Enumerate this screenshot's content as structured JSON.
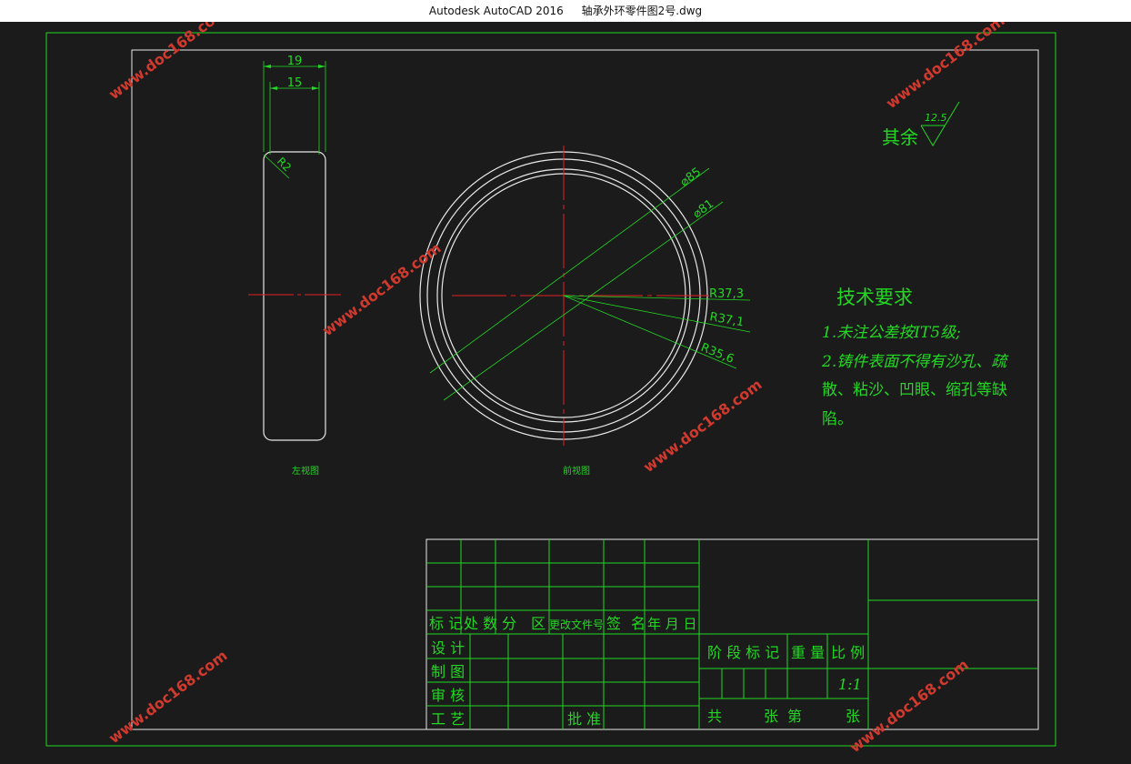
{
  "titlebar": {
    "app": "Autodesk AutoCAD 2016",
    "file": "轴承外环零件图2号.dwg"
  },
  "drawing": {
    "dims": {
      "width_outer": "19",
      "width_inner": "15",
      "fillet": "R2",
      "dia_outer": "⌀85",
      "dia_inner": "⌀81",
      "r1": "R37,3",
      "r2": "R37,1",
      "r3": "R35,6"
    },
    "view_left_label": "左视图",
    "view_front_label": "前视图",
    "surface": {
      "prefix": "其余",
      "value": "12.5"
    },
    "tech": {
      "title": "技术要求",
      "lines": [
        "1.未注公差按IT5级;",
        "2.铸件表面不得有沙孔、疏",
        "散、粘沙、凹眼、缩孔等缺",
        "陷。"
      ]
    }
  },
  "titleblock": {
    "header": [
      "标 记",
      "处 数",
      "分",
      "区",
      "更改文件号",
      "签",
      "名",
      "年 月 日"
    ],
    "rows": [
      "设 计",
      "制 图",
      "审 核",
      "工 艺"
    ],
    "approve": "批 准",
    "stage_label": "阶 段 标 记",
    "weight_label": "重 量",
    "scale_label": "比 例",
    "scale_value": "1:1",
    "total": "共",
    "sheets": "张",
    "page": "第",
    "sheet2": "张"
  },
  "watermark": "www.doc168.com",
  "colors": {
    "background": "#1b1b1b",
    "green": "#22d822",
    "white": "#e8e8e8",
    "red": "#e02020",
    "watermark": "#d0392e"
  }
}
